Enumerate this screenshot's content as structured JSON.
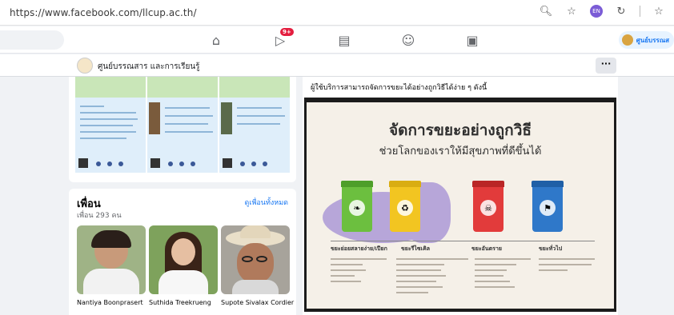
{
  "browser": {
    "url": "https://www.facebook.com/llcup.ac.th/",
    "icons": [
      "zoom-icon",
      "star-add-icon",
      "profile-icon",
      "refresh-icon",
      "favorites-icon"
    ],
    "profile_initials": "EN"
  },
  "fbnav": {
    "tabs": [
      "home-icon",
      "video-icon",
      "marketplace-icon",
      "groups-icon",
      "gaming-icon"
    ],
    "video_badge": "9+",
    "profile_name": "ศูนย์บรรณส"
  },
  "page": {
    "name": "ศูนย์บรรณสาร และการเรียนรู้",
    "more_label": "···"
  },
  "friends": {
    "title": "เพื่อน",
    "count": "เพื่อน 293 คน",
    "see_all": "ดูเพื่อนทั้งหมด",
    "items": [
      {
        "name": "Nantiya Boonprasert"
      },
      {
        "name": "Suthida Treekrueng"
      },
      {
        "name": "Supote Sivalax Cordier"
      }
    ]
  },
  "post": {
    "text": "ผู้ใช้บริการสามารถจัดการขยะได้อย่างถูกวิธีได้ง่าย ๆ ดังนี้",
    "poster_title": "จัดการขยะอย่างถูกวิธี",
    "poster_subtitle": "ช่วยโลกของเราให้มีสุขภาพที่ดีขึ้นได้",
    "bins": [
      {
        "label": "ขยะย่อยสลายง่าย/เปียก",
        "color": "#6cbf3f"
      },
      {
        "label": "ขยะรีไซเคิล",
        "color": "#f2c521"
      },
      {
        "label": "ขยะอันตราย",
        "color": "#e23b3b"
      },
      {
        "label": "ขยะทั่วไป",
        "color": "#2f78c9"
      }
    ]
  }
}
